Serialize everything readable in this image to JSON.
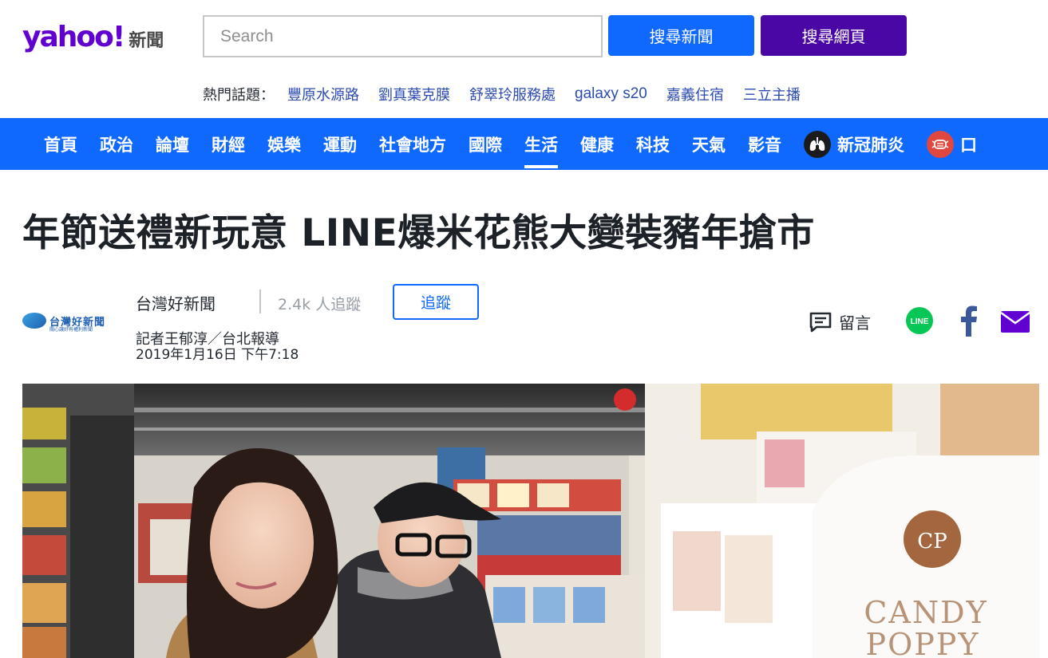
{
  "header": {
    "logo_yahoo": "yahoo!",
    "logo_section": "新聞",
    "search_placeholder": "Search",
    "search_news_label": "搜尋新聞",
    "search_web_label": "搜尋網頁"
  },
  "trending": {
    "label": "熱門話題：",
    "topics": [
      "豐原水源路",
      "劉真葉克膜",
      "舒翠玲服務處",
      "galaxy s20",
      "嘉義住宿",
      "三立主播"
    ]
  },
  "nav": {
    "items": [
      "首頁",
      "政治",
      "論壇",
      "財經",
      "娛樂",
      "運動",
      "社會地方",
      "國際",
      "生活",
      "健康",
      "科技",
      "天氣",
      "影音",
      "新冠肺炎",
      "口"
    ],
    "active": "生活"
  },
  "article": {
    "headline": "年節送禮新玩意 LINE爆米花熊大變裝豬年搶市",
    "source_name": "台灣好新聞",
    "source_logo_text": "台灣好新聞",
    "source_logo_tagline": "關心讓好有權利新聞",
    "followers_count": "2.4k",
    "followers_label": "人追蹤",
    "follow_label": "追蹤",
    "byline": "記者王郁淳／台北報導",
    "published": "2019年1月16日 下午7:18"
  },
  "share": {
    "comment_label": "留言",
    "line_label": "LINE"
  },
  "hero": {
    "sign_line1": "CANDY",
    "sign_line2": "POPPY",
    "brand_mark": "CP"
  },
  "colors": {
    "yahoo_purple": "#6001d2",
    "nav_blue": "#0f69ff",
    "search_web_purple": "#4b06a6",
    "line_green": "#06c755",
    "facebook_blue": "#3b5998",
    "mail_purple": "#6001d2"
  }
}
